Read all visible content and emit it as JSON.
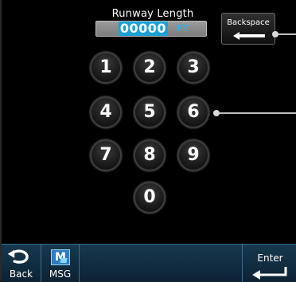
{
  "header": {
    "title": "Runway Length",
    "value": "00000",
    "unit": "FT"
  },
  "buttons": {
    "backspace": "Backspace",
    "back": "Back",
    "msg": "MSG",
    "enter": "Enter",
    "msg_icon_letter": "M"
  },
  "keypad": [
    "1",
    "2",
    "3",
    "4",
    "5",
    "6",
    "7",
    "8",
    "9",
    "0"
  ],
  "colors": {
    "highlight": "#1aa1d8",
    "bar": "#16384f"
  }
}
